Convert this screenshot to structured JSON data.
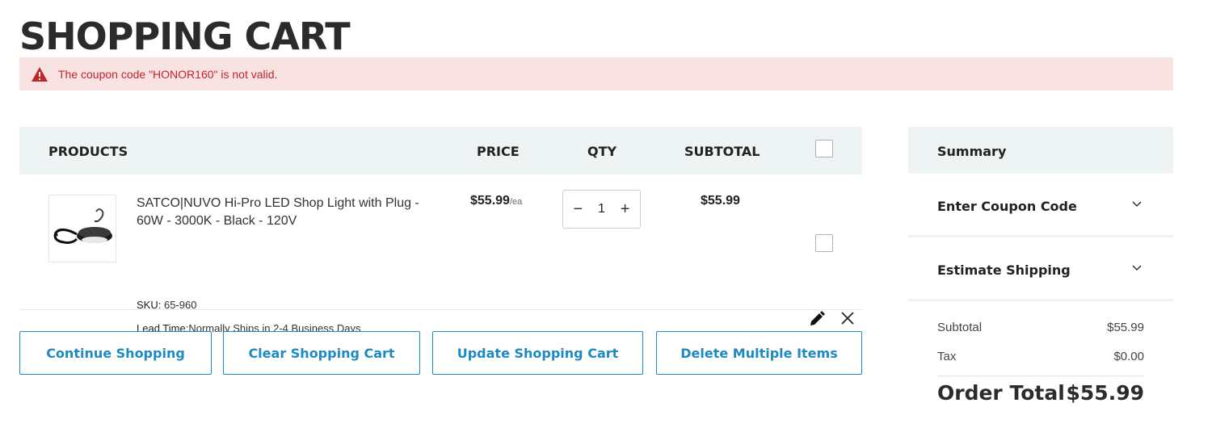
{
  "page": {
    "title": "SHOPPING CART"
  },
  "alert": {
    "message": "The coupon code \"HONOR160\" is not valid.",
    "color": "#c0262b"
  },
  "table": {
    "headers": {
      "products": "PRODUCTS",
      "price": "PRICE",
      "qty": "QTY",
      "subtotal": "SUBTOTAL"
    },
    "items": [
      {
        "name": "SATCO|NUVO Hi-Pro LED Shop Light with Plug - 60W - 3000K - Black - 120V",
        "sku_label": "SKU:",
        "sku": "65-960",
        "lead_label": "Lead Time:",
        "lead": "Normally Ships in 2-4 Business Days",
        "price": "$55.99",
        "price_unit": "/ea",
        "qty": "1",
        "qty_minus": "−",
        "qty_plus": "+",
        "subtotal": "$55.99",
        "image_icon": "shop-light-image"
      }
    ]
  },
  "actions": {
    "continue": "Continue Shopping",
    "clear": "Clear Shopping Cart",
    "update": "Update Shopping Cart",
    "delete_multiple": "Delete Multiple Items"
  },
  "summary": {
    "title": "Summary",
    "coupon_label": "Enter Coupon Code",
    "shipping_label": "Estimate Shipping",
    "subtotal_label": "Subtotal",
    "subtotal_value": "$55.99",
    "tax_label": "Tax",
    "tax_value": "$0.00",
    "order_total_label": "Order Total",
    "order_total_value": "$55.99"
  },
  "colors": {
    "accent": "#1d8ac2",
    "alert_bg": "#f8e2e2",
    "header_bg": "#eef3f3"
  }
}
